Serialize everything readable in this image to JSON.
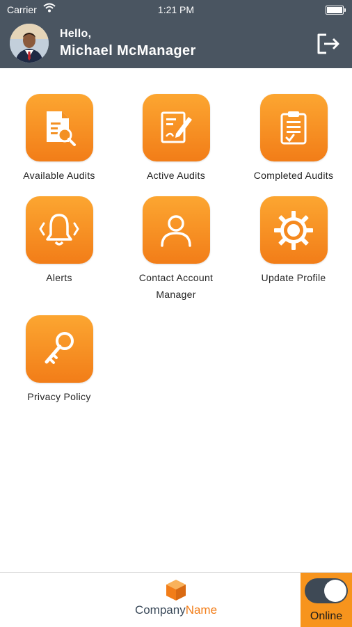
{
  "status_bar": {
    "carrier": "Carrier",
    "time": "1:21 PM"
  },
  "header": {
    "greeting": "Hello,",
    "user_name": "Michael McManager"
  },
  "menu": [
    {
      "label": "Available Audits",
      "icon": "document-search-icon"
    },
    {
      "label": "Active Audits",
      "icon": "edit-document-icon"
    },
    {
      "label": "Completed Audits",
      "icon": "clipboard-check-icon"
    },
    {
      "label": "Alerts",
      "icon": "bell-icon"
    },
    {
      "label": "Contact Account Manager",
      "icon": "person-icon"
    },
    {
      "label": "Update Profile",
      "icon": "gear-icon"
    },
    {
      "label": "Privacy Policy",
      "icon": "key-icon"
    }
  ],
  "footer": {
    "company_name_part1": "Company",
    "company_name_part2": "Name",
    "status_label": "Online",
    "status_on": true
  },
  "colors": {
    "header": "#4a5561",
    "accent": "#f7941d",
    "accent_dark": "#f27d18"
  }
}
